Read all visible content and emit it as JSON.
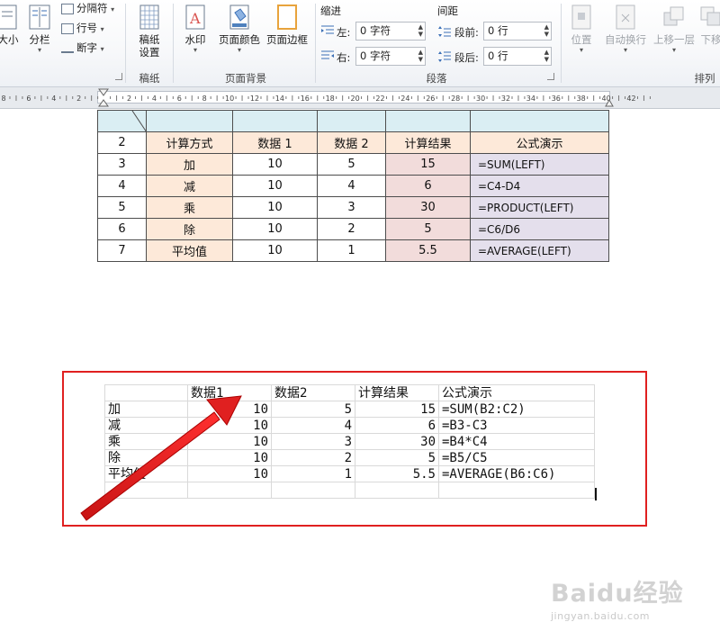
{
  "ribbon": {
    "page_setup_partial": {
      "size_label": "大小",
      "columns_label": "分栏",
      "breaks_label": "分隔符",
      "line_numbers_label": "行号",
      "hyphenation_label": "断字"
    },
    "manuscript": {
      "button_label": "稿纸\n设置",
      "button_line1": "稿纸",
      "button_line2": "设置",
      "group_label": "稿纸"
    },
    "page_background": {
      "watermark_label": "水印",
      "page_color_label": "页面颜色",
      "page_border_label": "页面边框",
      "group_label": "页面背景"
    },
    "paragraph": {
      "indent_heading": "缩进",
      "spacing_heading": "间距",
      "left_label": "左:",
      "left_value": "0 字符",
      "right_label": "右:",
      "right_value": "0 字符",
      "before_label": "段前:",
      "before_value": "0 行",
      "after_label": "段后:",
      "after_value": "0 行",
      "group_label": "段落"
    },
    "arrange": {
      "position_label": "位置",
      "wrap_label": "自动换行",
      "bring_forward_label": "上移一层",
      "send_backward_label": "下移",
      "group_label": "排列"
    }
  },
  "ruler": {
    "ticks": [
      "8",
      "6",
      "4",
      "2",
      "",
      "2",
      "4",
      "6",
      "8",
      "10",
      "12",
      "14",
      "16",
      "18",
      "20",
      "22",
      "24",
      "26",
      "28",
      "30",
      "32",
      "34",
      "36",
      "38",
      "40",
      "42"
    ]
  },
  "word_table": {
    "header": [
      "2",
      "计算方式",
      "数据 1",
      "数据 2",
      "计算结果",
      "公式演示"
    ],
    "rows": [
      [
        "3",
        "加",
        "10",
        "5",
        "15",
        "=SUM(LEFT)"
      ],
      [
        "4",
        "减",
        "10",
        "4",
        "6",
        "=C4-D4"
      ],
      [
        "5",
        "乘",
        "10",
        "3",
        "30",
        "=PRODUCT(LEFT)"
      ],
      [
        "6",
        "除",
        "10",
        "2",
        "5",
        "=C6/D6"
      ],
      [
        "7",
        "平均值",
        "10",
        "1",
        "5.5",
        "=AVERAGE(LEFT)"
      ]
    ],
    "colors": {
      "header_top": "#daeef3",
      "header_row": "#fde9d9",
      "col_method": "#fde9d9",
      "col_result": "#f2dcdb",
      "col_formula": "#e4dfec",
      "col_plain": "#ffffff"
    }
  },
  "excel_table": {
    "header": [
      "",
      "数据1",
      "数据2",
      "计算结果",
      "公式演示"
    ],
    "rows": [
      [
        "加",
        "10",
        "5",
        "15",
        "=SUM(B2:C2)"
      ],
      [
        "减",
        "10",
        "4",
        "6",
        "=B3-C3"
      ],
      [
        "乘",
        "10",
        "3",
        "30",
        "=B4*C4"
      ],
      [
        "除",
        "10",
        "2",
        "5",
        "=B5/C5"
      ],
      [
        "平均值",
        "10",
        "1",
        "5.5",
        "=AVERAGE(B6:C6)"
      ]
    ]
  },
  "annotation": {
    "box_color": "#e02020",
    "arrow_color": "#e02020"
  },
  "watermark": {
    "text": "Baidu经验",
    "url": "jingyan.baidu.com"
  }
}
